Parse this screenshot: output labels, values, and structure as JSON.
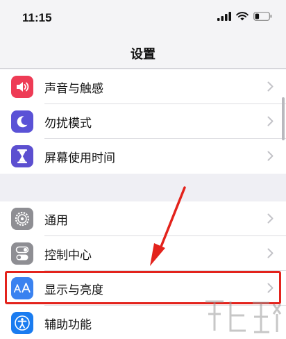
{
  "status_bar": {
    "time": "11:15"
  },
  "nav": {
    "title": "设置"
  },
  "groups": [
    {
      "items": [
        {
          "label": "声音与触感",
          "icon": "speaker-icon",
          "color": "#ee3b55"
        },
        {
          "label": "勿扰模式",
          "icon": "moon-icon",
          "color": "#5a52d6"
        },
        {
          "label": "屏幕使用时间",
          "icon": "hourglass-icon",
          "color": "#5c4fd0"
        }
      ]
    },
    {
      "items": [
        {
          "label": "通用",
          "icon": "gear-icon",
          "color": "#8e8e93"
        },
        {
          "label": "控制中心",
          "icon": "toggle-icon",
          "color": "#8e8e93"
        },
        {
          "label": "显示与亮度",
          "icon": "text-size-icon",
          "color": "#3a82f0"
        },
        {
          "label": "辅助功能",
          "icon": "accessibility-icon",
          "color": "#1a7cf0"
        }
      ]
    }
  ],
  "annotation": {
    "highlight_color": "#e3231c"
  }
}
